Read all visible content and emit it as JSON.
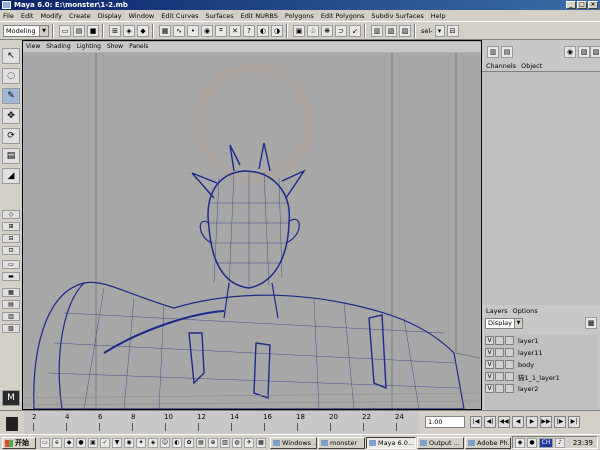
{
  "window": {
    "title": "Maya 6.0: E:\\monster\\1-2.mb"
  },
  "menubar": [
    "File",
    "Edit",
    "Modify",
    "Create",
    "Display",
    "Window",
    "Edit Curves",
    "Surfaces",
    "Edit NURBS",
    "Polygons",
    "Edit Polygons",
    "Subdiv Surfaces",
    "Help"
  ],
  "shelf": {
    "mode": "Modeling",
    "sel_label": "sel-"
  },
  "panel_menu": [
    "View",
    "Shading",
    "Lighting",
    "Show",
    "Panels"
  ],
  "channel_box": {
    "tabs": [
      "Channels",
      "Object"
    ]
  },
  "layer_panel": {
    "menu": [
      "Layers",
      "Options"
    ],
    "display_mode": "Display",
    "layers": [
      {
        "visible": "V",
        "name": "layer1"
      },
      {
        "visible": "V",
        "name": "layer11"
      },
      {
        "visible": "V",
        "name": "body"
      },
      {
        "visible": "V",
        "name": "猫1_1_layer1"
      },
      {
        "visible": "V",
        "name": "layer2"
      }
    ]
  },
  "timeline": {
    "ticks": [
      "2",
      "4",
      "6",
      "8",
      "10",
      "12",
      "14",
      "16",
      "18",
      "20",
      "22",
      "24"
    ],
    "current_frame": "1.00"
  },
  "taskbar": {
    "start": "开始",
    "tasks": [
      {
        "label": "Windows ..."
      },
      {
        "label": "monster"
      },
      {
        "label": "Maya 6.0..."
      },
      {
        "label": "Output ..."
      },
      {
        "label": "Adobe Ph..."
      }
    ],
    "tray_label": "CH",
    "clock": "23:39"
  },
  "colors": {
    "title_bar": "#0a246a",
    "viewport_bg": "#a7a7a7",
    "wireframe": "#1c2a8a"
  }
}
